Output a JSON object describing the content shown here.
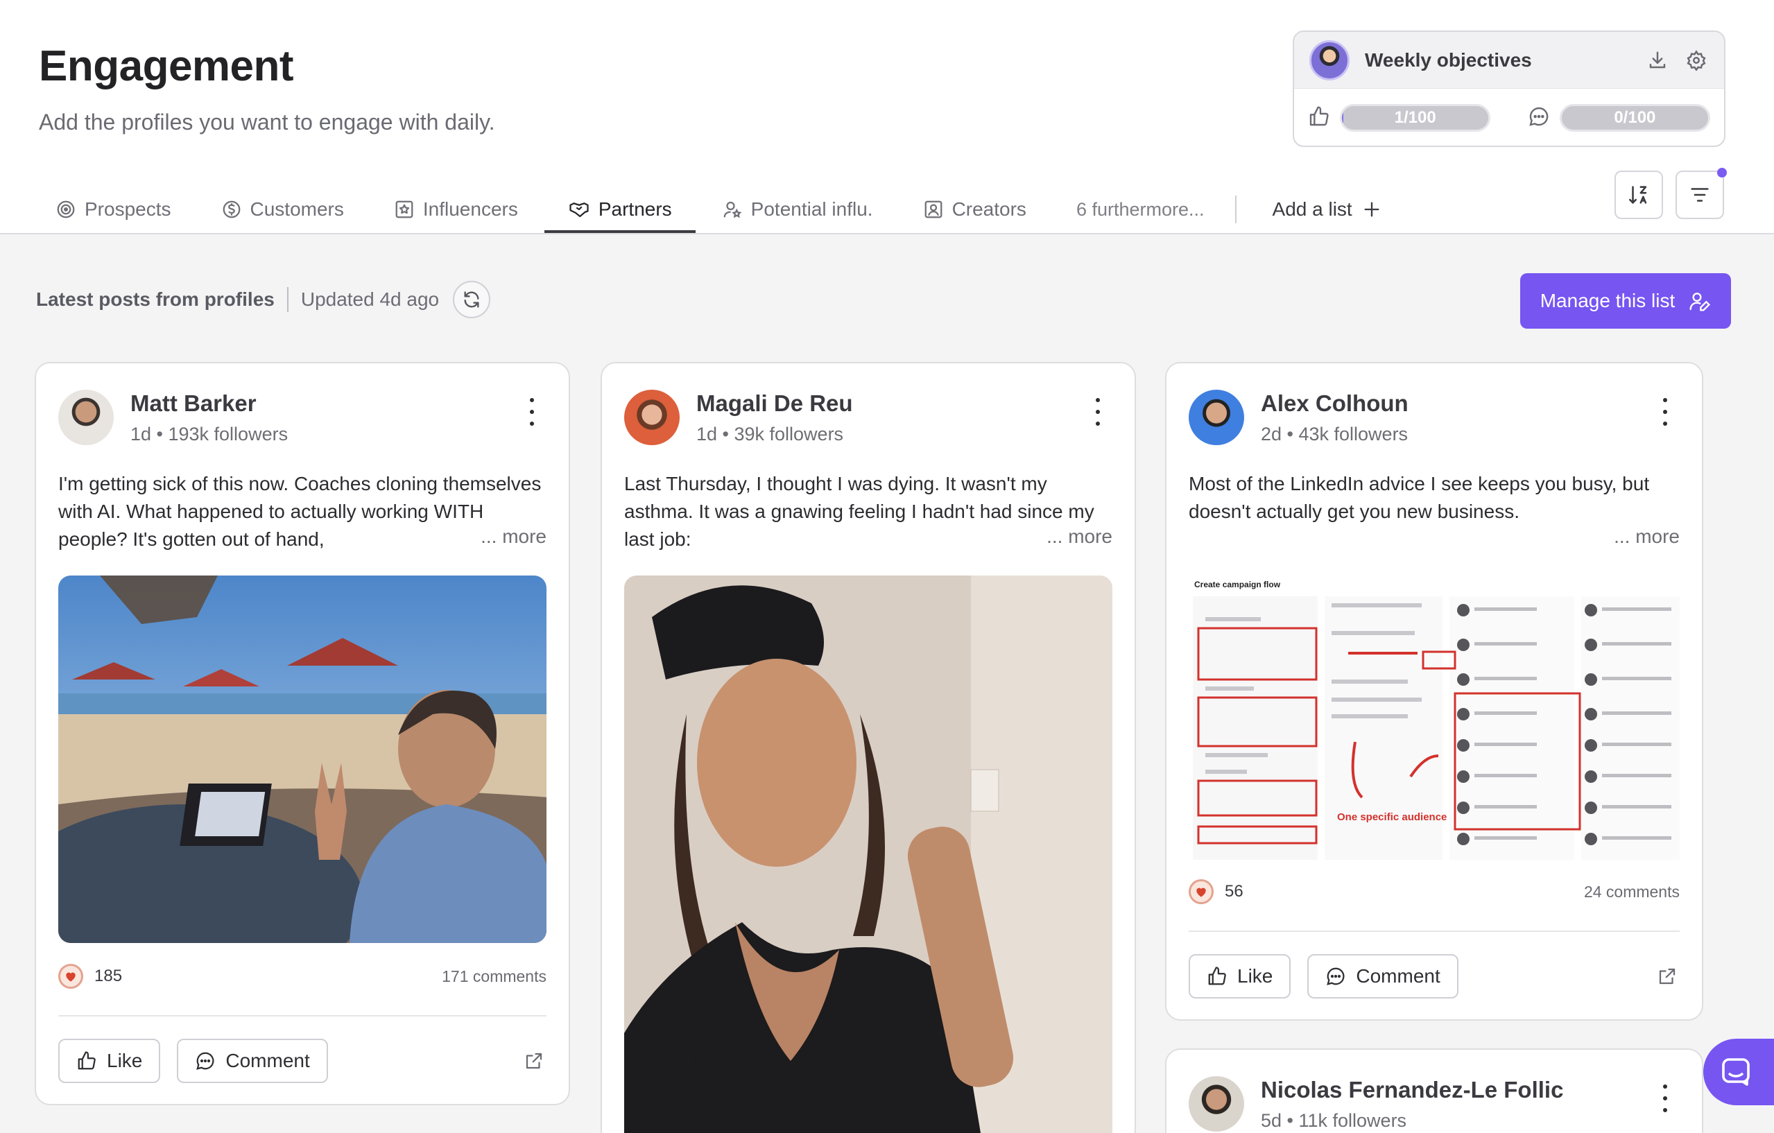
{
  "header": {
    "title": "Engagement",
    "subtitle": "Add the profiles you want to engage with daily."
  },
  "objectives": {
    "title": "Weekly objectives",
    "likes_label": "1/100",
    "likes_progress": 0.01,
    "comments_label": "0/100",
    "comments_progress": 0.0
  },
  "tabs": [
    {
      "label": "Prospects",
      "icon": "target-icon"
    },
    {
      "label": "Customers",
      "icon": "dollar-icon"
    },
    {
      "label": "Influencers",
      "icon": "star-badge-icon"
    },
    {
      "label": "Partners",
      "icon": "handshake-icon"
    },
    {
      "label": "Potential influ.",
      "icon": "user-star-icon"
    },
    {
      "label": "Creators",
      "icon": "portrait-icon"
    }
  ],
  "tabs_more": "6 furthermore...",
  "add_list": "Add a list",
  "active_tab": "Partners",
  "section": {
    "label": "Latest posts from profiles",
    "updated": "Updated 4d ago"
  },
  "manage_button": "Manage this list",
  "posts": [
    {
      "name": "Matt Barker",
      "meta": "1d • 193k followers",
      "text": "I'm getting sick of this now. Coaches cloning themselves with AI. What happened to actually working WITH people? It's gotten out of hand,",
      "more": "... more",
      "likes": "185",
      "comments": "171 comments",
      "like_label": "Like",
      "comment_label": "Comment"
    },
    {
      "name": "Magali De Reu",
      "meta": "1d • 39k followers",
      "text": "Last Thursday, I thought I was dying. It wasn't my asthma. It was a gnawing feeling I hadn't had since my last job:",
      "more": "... more"
    },
    {
      "name": "Alex Colhoun",
      "meta": "2d • 43k followers",
      "text": "Most of the LinkedIn advice I see keeps you busy, but doesn't actually get you new business.",
      "more": "... more",
      "likes": "56",
      "comments": "24 comments",
      "like_label": "Like",
      "comment_label": "Comment",
      "image_caption": "Create campaign flow",
      "image_annotation": "One specific audience"
    },
    {
      "name": "Nicolas Fernandez-Le Follic",
      "meta": "5d • 11k followers"
    }
  ],
  "colors": {
    "accent": "#7655f1",
    "progress": "#7b6cf0"
  }
}
